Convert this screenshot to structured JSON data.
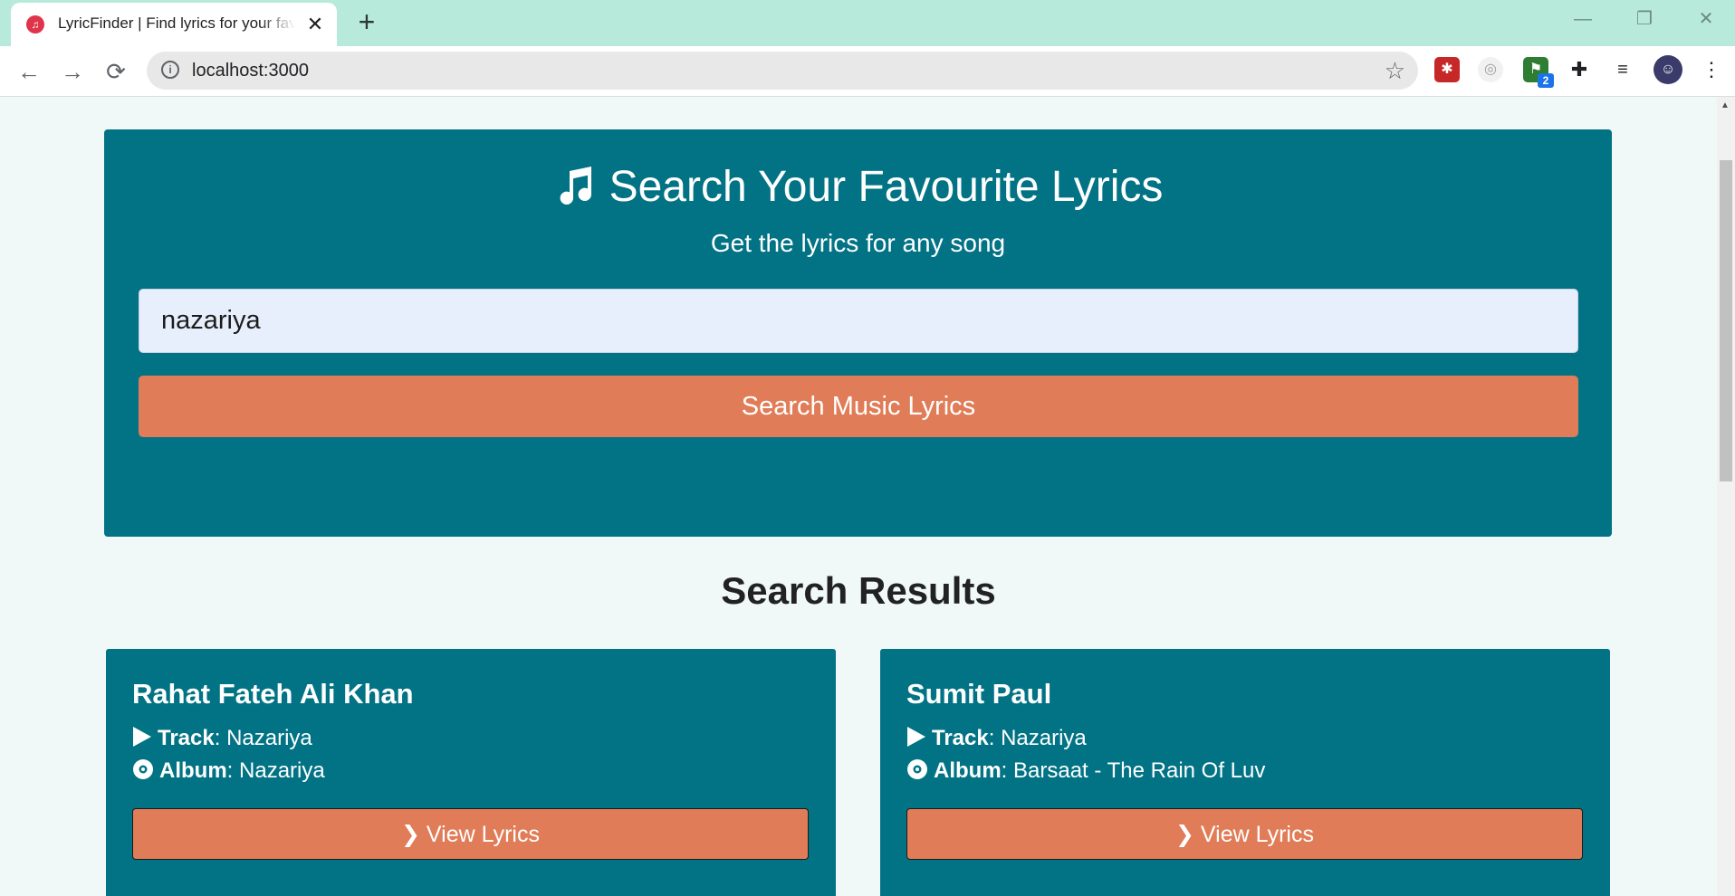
{
  "browser": {
    "tab_title": "LyricFinder | Find lyrics for your favourite songs",
    "tab_favicon": "music-note",
    "url": "localhost:3000",
    "extensions": [
      {
        "name": "ext-red-icon",
        "color": "#c62828"
      },
      {
        "name": "ext-target-icon",
        "color": "#9e9e9e"
      },
      {
        "name": "ext-flag-icon",
        "color": "#2e7d32",
        "badge": "2"
      },
      {
        "name": "puzzle-icon",
        "color": "#202124"
      },
      {
        "name": "media-queue-icon",
        "color": "#202124"
      },
      {
        "name": "profile-avatar",
        "color": "#3b3b6b"
      }
    ]
  },
  "hero": {
    "title": "Search Your Favourite Lyrics",
    "subtitle": "Get the lyrics for any song",
    "search_value": "nazariya",
    "search_button": "Search Music Lyrics"
  },
  "results": {
    "heading": "Search Results",
    "track_label": "Track",
    "album_label": "Album",
    "view_label": "View Lyrics",
    "items": [
      {
        "artist": "Rahat Fateh Ali Khan",
        "track": "Nazariya",
        "album": "Nazariya"
      },
      {
        "artist": "Sumit Paul",
        "track": "Nazariya",
        "album": "Barsaat - The Rain Of Luv"
      }
    ]
  },
  "colors": {
    "brand_teal": "#027385",
    "accent_orange": "#e07c57",
    "tabstrip": "#b8eadb",
    "page_bg": "#f0f8f8"
  }
}
